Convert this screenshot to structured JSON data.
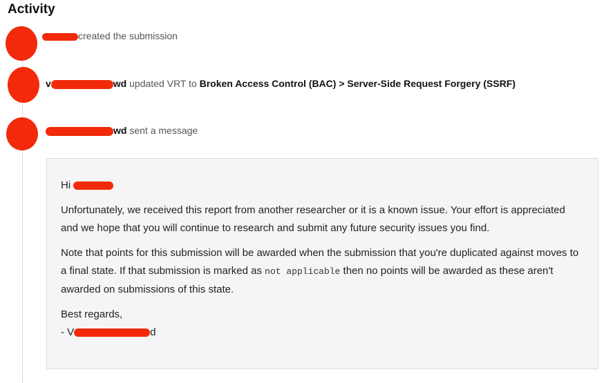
{
  "activity": {
    "title": "Activity"
  },
  "events": [
    {
      "user_suffix": "",
      "verb": "created the submission"
    },
    {
      "user_prefix": "v",
      "user_suffix": "wd",
      "verb": "updated VRT to",
      "detail": "Broken Access Control (BAC) > Server-Side Request Forgery (SSRF)"
    },
    {
      "user_suffix": "wd",
      "verb": "sent a message"
    }
  ],
  "message": {
    "greeting": "Hi",
    "paragraph1": "Unfortunately, we received this report from another researcher or it is a known issue. Your effort is appreciated and we hope that you will continue to research and submit any future security issues you find.",
    "paragraph2_before": "Note that points for this submission will be awarded when the submission that you're duplicated against moves to a final state. If that submission is marked as",
    "paragraph2_code": "not applicable",
    "paragraph2_after": "then no points will be awarded as these aren't awarded on submissions of this state.",
    "closing": "Best regards,",
    "signature_prefix": "- V",
    "signature_suffix": "d"
  },
  "colors": {
    "redaction": "#f22a0a",
    "message_bg": "#f5f5f5"
  }
}
